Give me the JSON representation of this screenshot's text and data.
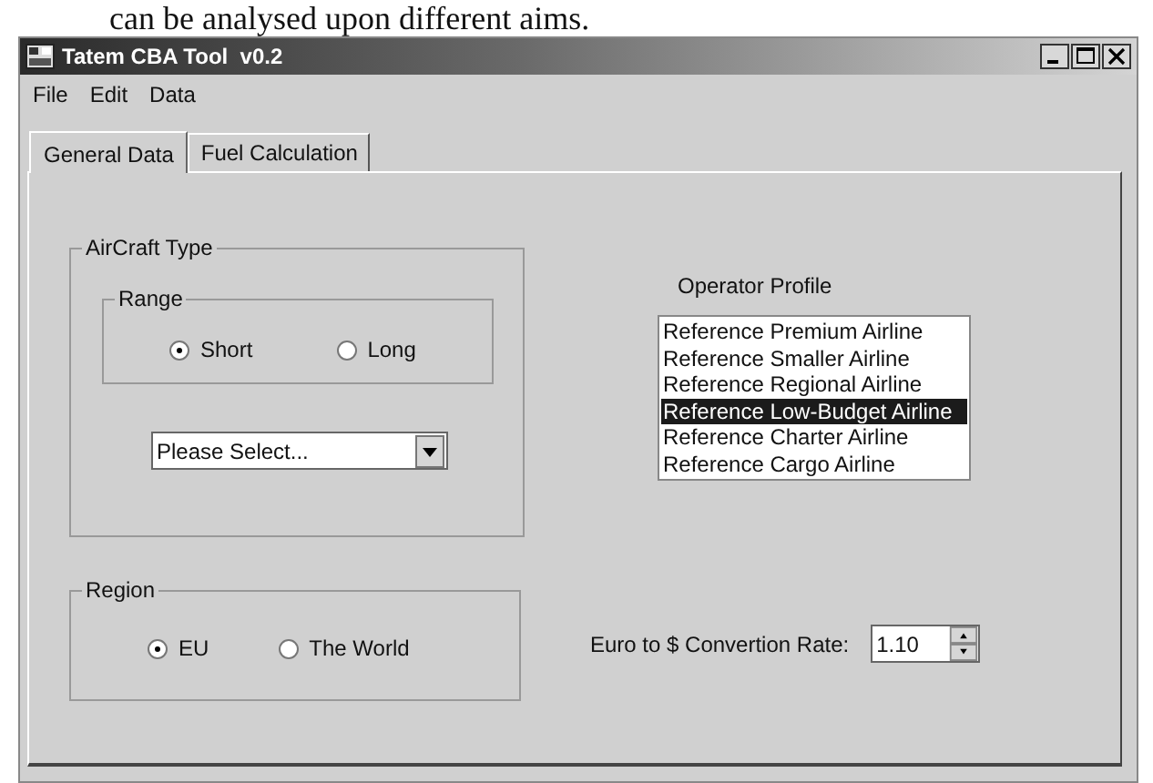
{
  "document_text": "can be analysed upon different aims.",
  "window": {
    "title": "Tatem CBA Tool  v0.2"
  },
  "menu": [
    "File",
    "Edit",
    "Data"
  ],
  "tabs": [
    {
      "label": "General Data",
      "selected": true
    },
    {
      "label": "Fuel Calculation",
      "selected": false
    }
  ],
  "aircraft_type": {
    "title": "AirCraft Type",
    "range": {
      "title": "Range",
      "options": [
        {
          "label": "Short",
          "selected": true
        },
        {
          "label": "Long",
          "selected": false
        }
      ]
    },
    "dropdown": {
      "value": "Please Select..."
    }
  },
  "region": {
    "title": "Region",
    "options": [
      {
        "label": "EU",
        "selected": true
      },
      {
        "label": "The World",
        "selected": false
      }
    ]
  },
  "operator_profile": {
    "label": "Operator Profile",
    "items": [
      {
        "label": "Reference Premium Airline",
        "selected": false
      },
      {
        "label": "Reference Smaller Airline",
        "selected": false
      },
      {
        "label": "Reference Regional Airline",
        "selected": false
      },
      {
        "label": "Reference Low-Budget Airline",
        "selected": true
      },
      {
        "label": "Reference Charter Airline",
        "selected": false
      },
      {
        "label": "Reference Cargo Airline",
        "selected": false
      }
    ]
  },
  "conversion": {
    "label": "Euro to $ Convertion Rate:",
    "value": "1.10"
  }
}
